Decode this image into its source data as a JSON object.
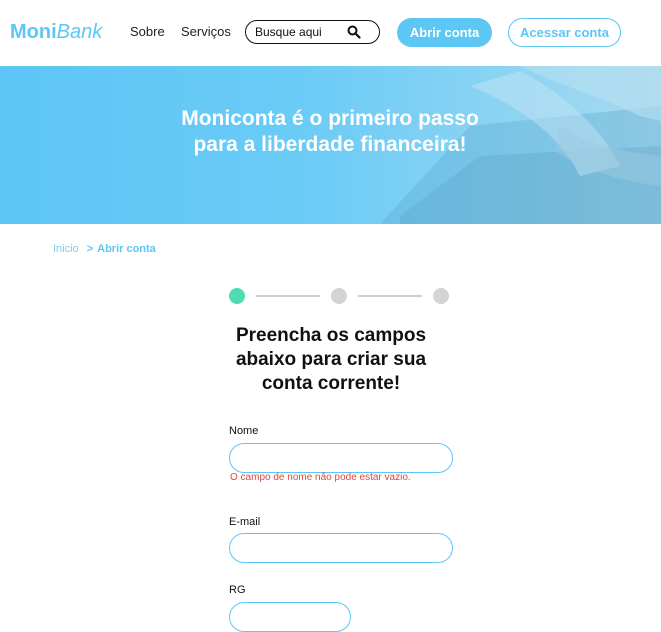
{
  "brand": {
    "logo_bold": "Moni",
    "logo_italic": "Bank"
  },
  "nav": {
    "sobre": "Sobre",
    "servicos": "Serviços"
  },
  "search": {
    "placeholder": "Busque aqui"
  },
  "header_buttons": {
    "open_account": "Abrir conta",
    "access_account": "Acessar conta"
  },
  "hero": {
    "title": "Moniconta é o primeiro passo para a liberdade financeira!"
  },
  "breadcrumb": {
    "home": "Inicio",
    "separator": ">",
    "current": "Abrir conta"
  },
  "stepper": {
    "current_step": 1,
    "total_steps": 3
  },
  "form": {
    "title": "Preencha os campos abaixo para criar sua conta corrente!",
    "fields": {
      "nome": {
        "label": "Nome",
        "value": "",
        "error": "O campo de nome não pode estar vazio."
      },
      "email": {
        "label": "E-mail",
        "value": ""
      },
      "rg": {
        "label": "RG",
        "value": ""
      }
    }
  },
  "colors": {
    "accent": "#5cc6f5",
    "step_active": "#4fdcb3",
    "error": "#e0463c"
  }
}
